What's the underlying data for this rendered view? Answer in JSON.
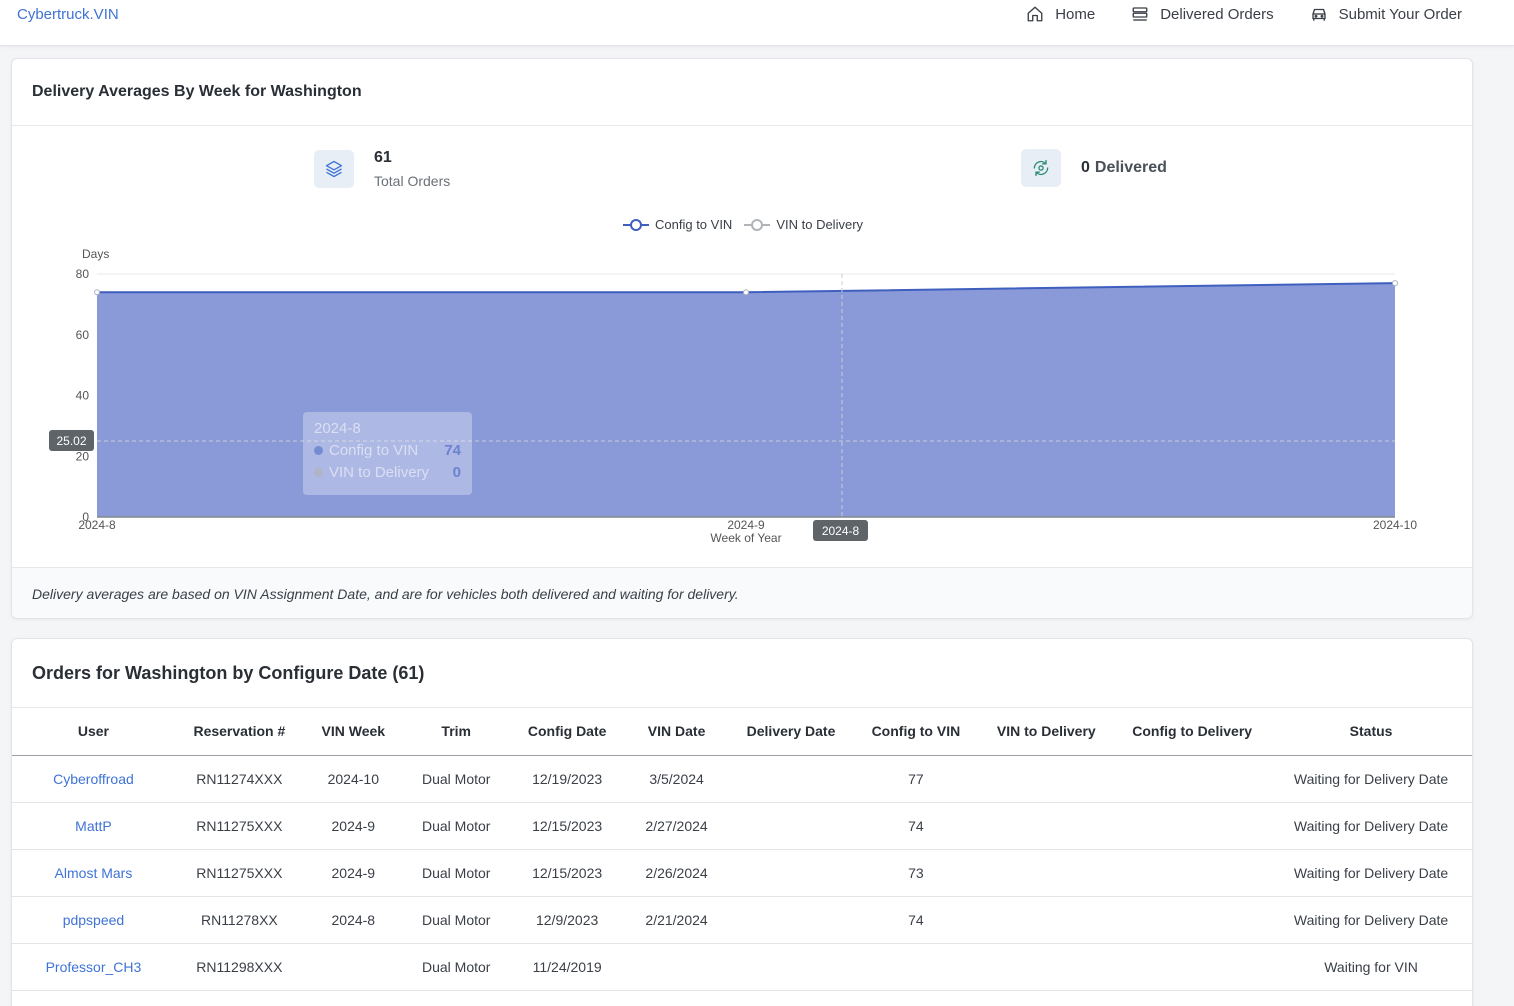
{
  "nav": {
    "brand": "Cybertruck.VIN",
    "items": [
      {
        "label": "Home",
        "icon": "home-icon"
      },
      {
        "label": "Delivered Orders",
        "icon": "list-icon"
      },
      {
        "label": "Submit Your Order",
        "icon": "car-icon"
      }
    ]
  },
  "chart_card": {
    "title": "Delivery Averages By Week for Washington",
    "total_orders_value": "61",
    "total_orders_label": "Total Orders",
    "delivered_value": "0",
    "delivered_label": "Delivered",
    "note": "Delivery averages are based on VIN Assignment Date, and are for vehicles both delivered and waiting for delivery.",
    "tooltip": {
      "title": "2024-8",
      "rows": [
        {
          "label": "Config to VIN",
          "value": "74"
        },
        {
          "label": "VIN to Delivery",
          "value": "0"
        }
      ]
    },
    "crosshair_y_label": "25.02",
    "crosshair_x_label": "2024-8"
  },
  "chart_data": {
    "type": "area",
    "x": [
      "2024-8",
      "2024-9",
      "2024-10"
    ],
    "series": [
      {
        "name": "Config to VIN",
        "values": [
          74,
          74,
          77
        ],
        "color": "#3f5fbf"
      },
      {
        "name": "VIN to Delivery",
        "values": [
          0,
          0,
          0
        ],
        "color": "#b0b4b8"
      }
    ],
    "xlabel": "Week of Year",
    "ylabel": "Days",
    "ylim": [
      0,
      80
    ],
    "yticks": [
      0,
      20,
      40,
      60,
      80
    ],
    "fill_color": "#8a9ad8",
    "grid": true,
    "legend_position": "top-center"
  },
  "orders": {
    "title": "Orders for Washington by Configure Date (61)",
    "columns": [
      "User",
      "Reservation #",
      "VIN Week",
      "Trim",
      "Config Date",
      "VIN Date",
      "Delivery Date",
      "Config to VIN",
      "VIN to Delivery",
      "Config to Delivery",
      "Status"
    ],
    "rows": [
      [
        "Cyberoffroad",
        "RN11274XXX",
        "2024-10",
        "Dual Motor",
        "12/19/2023",
        "3/5/2024",
        "",
        "77",
        "",
        "",
        "Waiting for Delivery Date"
      ],
      [
        "MattP",
        "RN11275XXX",
        "2024-9",
        "Dual Motor",
        "12/15/2023",
        "2/27/2024",
        "",
        "74",
        "",
        "",
        "Waiting for Delivery Date"
      ],
      [
        "Almost Mars",
        "RN11275XXX",
        "2024-9",
        "Dual Motor",
        "12/15/2023",
        "2/26/2024",
        "",
        "73",
        "",
        "",
        "Waiting for Delivery Date"
      ],
      [
        "pdpspeed",
        "RN11278XX",
        "2024-8",
        "Dual Motor",
        "12/9/2023",
        "2/21/2024",
        "",
        "74",
        "",
        "",
        "Waiting for Delivery Date"
      ],
      [
        "Professor_CH3",
        "RN11298XXX",
        "",
        "Dual Motor",
        "11/24/2019",
        "",
        "",
        "",
        "",
        "",
        "Waiting for VIN"
      ]
    ]
  }
}
